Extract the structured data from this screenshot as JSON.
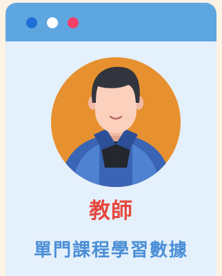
{
  "window": {
    "controls": [
      {
        "name": "close-dot",
        "color": "#1f6fd6"
      },
      {
        "name": "minimize-dot",
        "color": "#ffffff"
      },
      {
        "name": "maximize-dot",
        "color": "#f0406a"
      }
    ]
  },
  "profile": {
    "avatar_icon": "teacher-avatar-icon",
    "role": "教師",
    "subtitle": "單門課程學習數據"
  },
  "colors": {
    "page_bg": "#fdf3e4",
    "card_bg": "#e4f0fb",
    "titlebar": "#5ea6e0",
    "role_text": "#e8463c",
    "subtitle_text": "#4a8ed6",
    "avatar_bg": "#e7902f"
  }
}
